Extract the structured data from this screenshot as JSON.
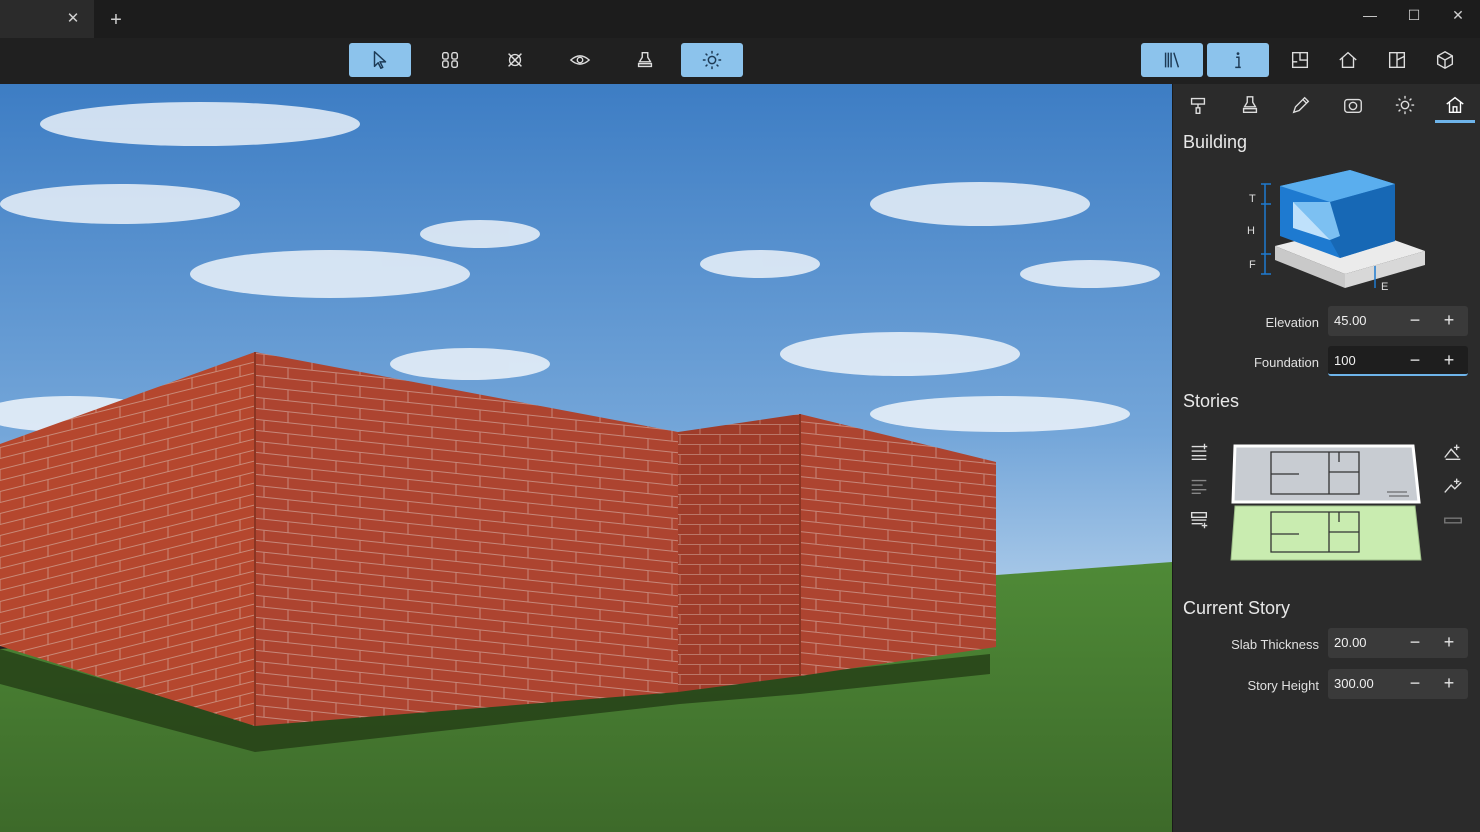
{
  "titlebar": {
    "tab_close": "✕",
    "new_tab": "+",
    "minimize": "—",
    "maximize": "☐",
    "close": "✕"
  },
  "toolbar": {
    "tools": [
      {
        "name": "select-tool-icon",
        "active": true
      },
      {
        "name": "walls-tool-icon",
        "active": false
      },
      {
        "name": "tools-icon",
        "active": false
      },
      {
        "name": "eye-icon",
        "active": false
      },
      {
        "name": "stamp-icon",
        "active": false
      },
      {
        "name": "sun-icon",
        "active": true
      }
    ],
    "right_tools": [
      {
        "name": "library-icon",
        "active": true
      },
      {
        "name": "info-icon",
        "active": true
      },
      {
        "name": "plan-2d-icon",
        "active": false
      },
      {
        "name": "house-icon",
        "active": false
      },
      {
        "name": "split-view-icon",
        "active": false
      },
      {
        "name": "view-3d-icon",
        "active": false
      }
    ]
  },
  "panel_tabs": [
    "paint-icon",
    "stamp-icon",
    "pencil-icon",
    "camera-icon",
    "sun-icon",
    "building-icon"
  ],
  "building": {
    "title": "Building",
    "diagram_labels": {
      "t": "T",
      "h": "H",
      "f": "F",
      "e": "E"
    },
    "elevation_label": "Elevation",
    "elevation_value": "45.00",
    "foundation_label": "Foundation",
    "foundation_value": "100"
  },
  "stories": {
    "title": "Stories"
  },
  "current_story": {
    "title": "Current Story",
    "slab_label": "Slab Thickness",
    "slab_value": "20.00",
    "height_label": "Story Height",
    "height_value": "300.00"
  },
  "controls": {
    "minus": "−",
    "plus": "+"
  },
  "colors": {
    "accent": "#8cc3ec",
    "focus": "#6eb4ea",
    "brick": "#b3492f",
    "grass": "#4a7a33",
    "story_selected": "#c8ccd2",
    "story_ground": "#c9ecb0"
  }
}
